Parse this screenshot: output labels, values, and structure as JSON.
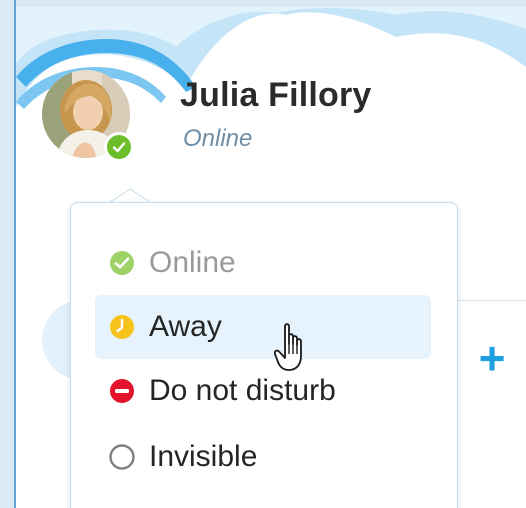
{
  "profile": {
    "name": "Julia Fillory",
    "status": "Online"
  },
  "status_menu": {
    "items": [
      {
        "label": "Online",
        "icon": "online-check-icon",
        "color": "#9fd169",
        "current": true
      },
      {
        "label": "Away",
        "icon": "away-clock-icon",
        "color": "#f8c21c",
        "hovered": true
      },
      {
        "label": "Do not disturb",
        "icon": "do-not-disturb-icon",
        "color": "#e3132c"
      },
      {
        "label": "Invisible",
        "icon": "invisible-circle-icon",
        "color": "#808080"
      }
    ]
  },
  "toolbar": {
    "add_label": "+"
  },
  "colors": {
    "accent": "#1d9fe2",
    "online": "#6cbf2a",
    "header_cloud": "#c4e4f7",
    "header_cloud_light": "#e0f1fb"
  }
}
